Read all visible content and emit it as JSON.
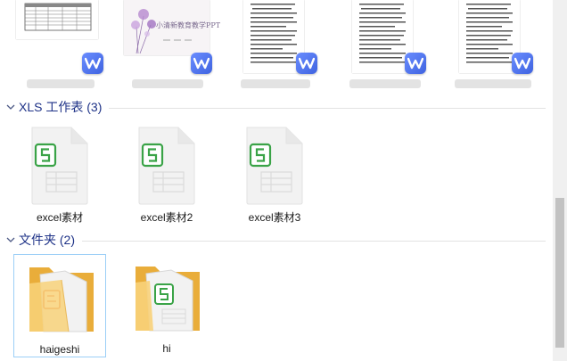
{
  "sections": {
    "xls": {
      "title": "XLS 工作表 (3)"
    },
    "folders": {
      "title": "文件夹 (2)"
    }
  },
  "xls_files": [
    {
      "name": "excel素材"
    },
    {
      "name": "excel素材2"
    },
    {
      "name": "excel素材3"
    }
  ],
  "folders": [
    {
      "name": "haigeshi"
    },
    {
      "name": "hi"
    }
  ],
  "top_thumbnails": [
    {
      "kind": "spreadsheet-preview"
    },
    {
      "kind": "ppt-preview",
      "caption": "小清新教育教学PPT"
    },
    {
      "kind": "document-preview"
    },
    {
      "kind": "document-preview"
    },
    {
      "kind": "document-preview"
    }
  ],
  "colors": {
    "section_title": "#1e3287",
    "wps_badge": "#4a6cf0",
    "excel_green": "#3aa347",
    "folder_yellow": "#f2c05a"
  }
}
